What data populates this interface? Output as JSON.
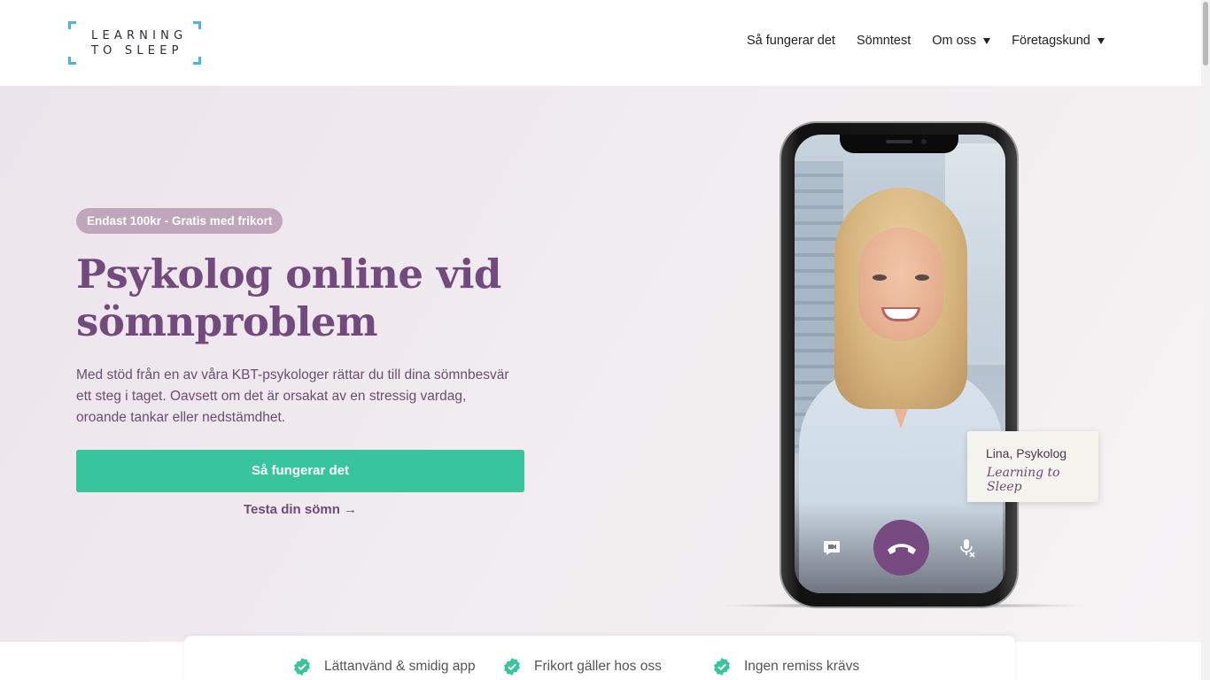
{
  "header": {
    "logo": {
      "line1": "LEARNING",
      "line2": "TO SLEEP"
    },
    "nav": [
      {
        "label": "Så fungerar det"
      },
      {
        "label": "Sömntest"
      },
      {
        "label": "Om oss"
      },
      {
        "label": "Företagskund"
      }
    ]
  },
  "hero": {
    "badge": "Endast 100kr - Gratis med frikort",
    "title_line1": "Psykolog online vid",
    "title_line2": "sömnproblem",
    "description": "Med stöd från en av våra KBT-psykologer rättar du till dina sömnbesvär ett steg i taget. Oavsett om det är orsakat av en stressig vardag, oroande tankar eller nedstämdhet.",
    "cta_primary": "Så fungerar det",
    "cta_secondary": "Testa din sömn →"
  },
  "call_card": {
    "name": "Lina, Psykolog",
    "brand": "Learning to Sleep"
  },
  "call_controls": {
    "left_icon": "chat-video-icon",
    "center_icon": "hang-up-icon",
    "right_icon": "mic-off-icon"
  },
  "features": [
    {
      "label": "Lättanvänd & smidig app",
      "icon": "check-badge-icon"
    },
    {
      "label": "Frikort gäller hos oss",
      "icon": "check-badge-icon"
    },
    {
      "label": "Ingen remiss krävs",
      "icon": "check-badge-icon"
    }
  ],
  "colors": {
    "accent_purple": "#734a7d",
    "cta_green": "#38c59d",
    "badge_bg": "#bfa6bb",
    "logo_blue": "#4fb3e0"
  }
}
